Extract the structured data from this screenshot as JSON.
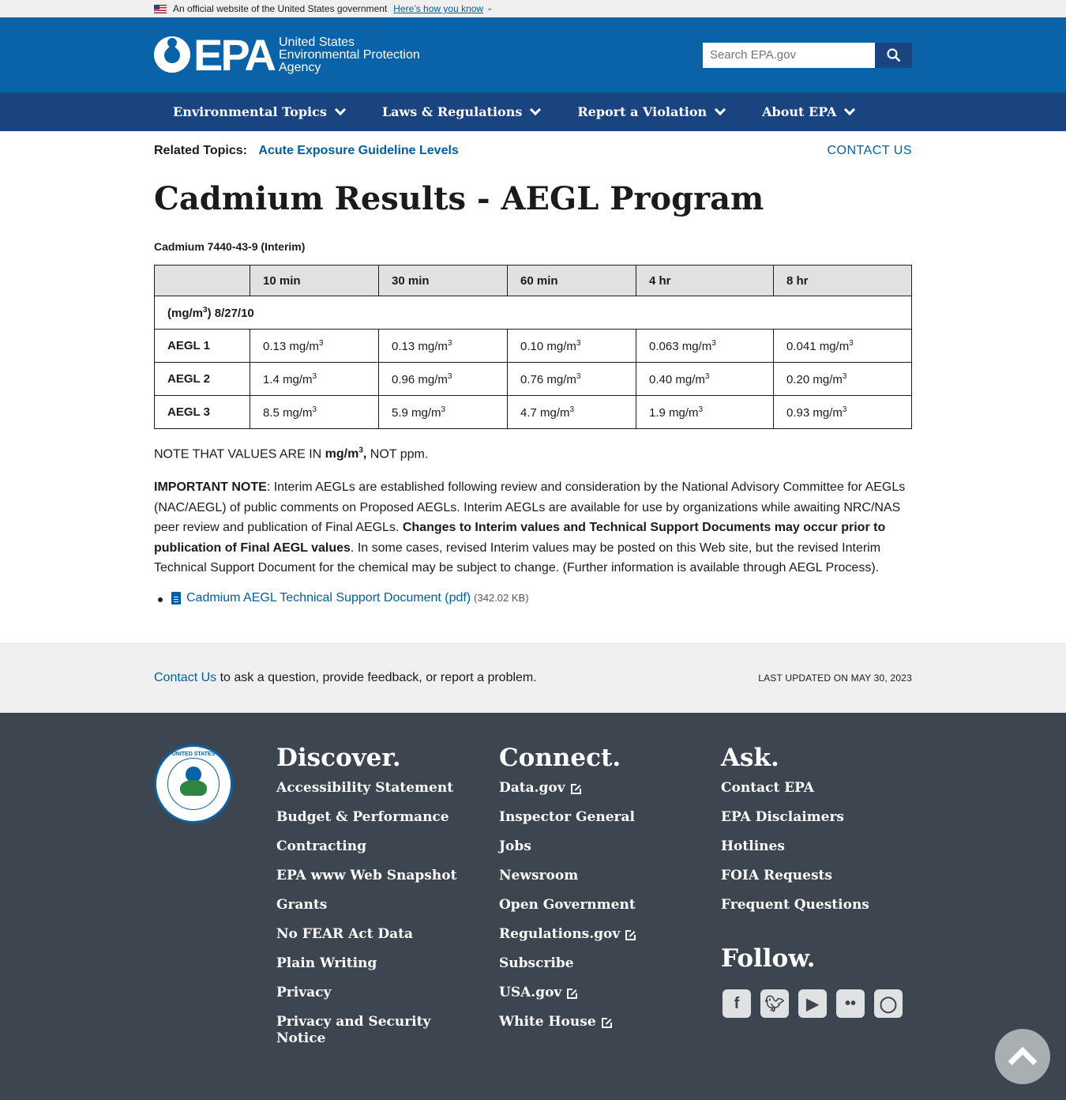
{
  "gov_banner": {
    "text": "An official website of the United States government",
    "link": "Here’s how you know"
  },
  "header": {
    "logo_abbr": "EPA",
    "logo_name_line1": "United States",
    "logo_name_line2": "Environmental Protection",
    "logo_name_line3": "Agency",
    "search_placeholder": "Search EPA.gov"
  },
  "nav": [
    {
      "label": "Environmental Topics"
    },
    {
      "label": "Laws & Regulations"
    },
    {
      "label": "Report a Violation"
    },
    {
      "label": "About EPA"
    }
  ],
  "related": {
    "label": "Related Topics:",
    "topic": "Acute Exposure Guideline Levels",
    "contact": "CONTACT US"
  },
  "page_title": "Cadmium Results - AEGL Program",
  "chemical": "Cadmium 7440-43-9 (Interim)",
  "table": {
    "headers": [
      "",
      "10 min",
      "30 min",
      "60 min",
      "4 hr",
      "8 hr"
    ],
    "unit_row_pre": "(mg/m",
    "unit_row_sup": "3",
    "unit_row_post": ") 8/27/10",
    "unit_suffix": " mg/m",
    "sup": "3",
    "rows": [
      {
        "label": "AEGL 1",
        "values": [
          "0.13",
          "0.13",
          "0.10",
          "0.063",
          "0.041"
        ]
      },
      {
        "label": "AEGL 2",
        "values": [
          "1.4",
          "0.96",
          "0.76",
          "0.40",
          "0.20"
        ]
      },
      {
        "label": "AEGL 3",
        "values": [
          "8.5",
          "5.9",
          "4.7",
          "1.9",
          "0.93"
        ]
      }
    ]
  },
  "note": {
    "pre": "NOTE THAT VALUES ARE IN ",
    "bold": "mg/m",
    "sup": "3",
    "bold_post": ",",
    "post": " NOT ppm."
  },
  "important": {
    "label": "IMPORTANT NOTE",
    "text1": ": Interim AEGLs are established following review and consideration by the National Advisory Committee for AEGLs (NAC/AEGL) of public comments on Proposed AEGLs. Interim AEGLs are available for use by organizations while awaiting NRC/NAS peer review and publication of Final AEGLs. ",
    "bold": "Changes to Interim values and Technical Support Documents may occur prior to publication of Final AEGL values",
    "text2": ". In some cases, revised Interim values may be posted on this Web site, but the revised Interim Technical Support Document for the chemical may be subject to change. (Further information is available through AEGL Process)."
  },
  "document": {
    "link": "Cadmium AEGL Technical Support Document (pdf)",
    "size": "(342.02 KB)"
  },
  "contact_strip": {
    "link": "Contact Us",
    "text": " to ask a question, provide feedback, or report a problem.",
    "updated": "LAST UPDATED ON MAY 30, 2023"
  },
  "footer": {
    "seal_text": "UNITED STATES",
    "discover": {
      "title": "Discover.",
      "items": [
        "Accessibility Statement",
        "Budget & Performance",
        "Contracting",
        "EPA www Web Snapshot",
        "Grants",
        "No FEAR Act Data",
        "Plain Writing",
        "Privacy",
        "Privacy and Security Notice"
      ]
    },
    "connect": {
      "title": "Connect.",
      "items": [
        {
          "label": "Data.gov",
          "external": true
        },
        {
          "label": "Inspector General",
          "external": false
        },
        {
          "label": "Jobs",
          "external": false
        },
        {
          "label": "Newsroom",
          "external": false
        },
        {
          "label": "Open Government",
          "external": false
        },
        {
          "label": "Regulations.gov",
          "external": true
        },
        {
          "label": "Subscribe",
          "external": false
        },
        {
          "label": "USA.gov",
          "external": true
        },
        {
          "label": "White House",
          "external": true
        }
      ]
    },
    "ask": {
      "title": "Ask.",
      "items": [
        "Contact EPA",
        "EPA Disclaimers",
        "Hotlines",
        "FOIA Requests",
        "Frequent Questions"
      ]
    },
    "follow": {
      "title": "Follow.",
      "icons": [
        "facebook-icon",
        "twitter-icon",
        "youtube-icon",
        "flickr-icon",
        "instagram-icon"
      ]
    }
  },
  "colors": {
    "header_blue": "#0a62a8",
    "nav_navy": "#1a4480",
    "link_blue": "#005ea2",
    "footer_gray": "#3d4551"
  }
}
